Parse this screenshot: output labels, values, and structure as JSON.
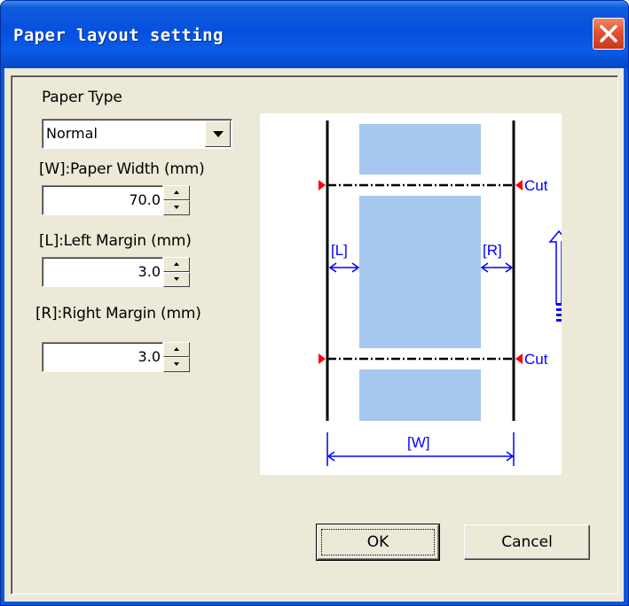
{
  "window": {
    "title": "Paper layout setting"
  },
  "form": {
    "paper_type_label": "Paper Type",
    "paper_type_value": "Normal",
    "paper_width_label": "[W]:Paper Width (mm)",
    "paper_width_value": "70.0",
    "left_margin_label": "[L]:Left Margin (mm)",
    "left_margin_value": "3.0",
    "right_margin_label": "[R]:Right Margin (mm)",
    "right_margin_value": "3.0"
  },
  "diagram": {
    "cut_label": "Cut",
    "left_label": "[L]",
    "right_label": "[R]",
    "width_label": "[W]",
    "paper_color": "#a6c8ee",
    "line_color": "#000000",
    "annotation_color": "#0000ff",
    "marker_color": "#ff0000"
  },
  "buttons": {
    "ok": "OK",
    "cancel": "Cancel"
  }
}
